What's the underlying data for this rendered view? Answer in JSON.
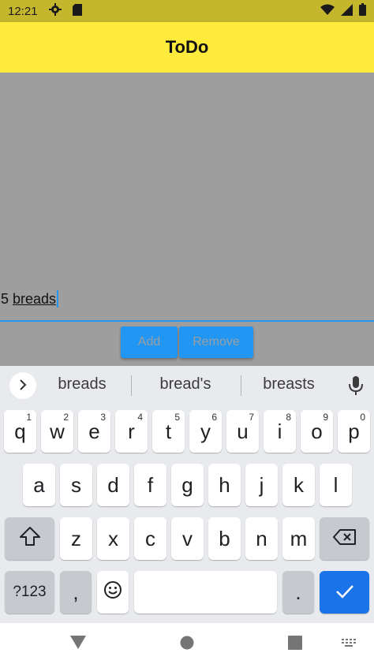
{
  "status_bar": {
    "time": "12:21",
    "icons": [
      "gear-icon",
      "sd-card-icon",
      "wifi-icon",
      "signal-icon",
      "battery-icon"
    ]
  },
  "app_bar": {
    "title": "ToDo",
    "color": "#ffeb3b"
  },
  "input": {
    "prefix": "5 ",
    "word": "breads"
  },
  "buttons": {
    "add": "Add",
    "remove": "Remove",
    "color": "#2196f3"
  },
  "keyboard": {
    "suggestions": [
      "breads",
      "bread's",
      "breasts"
    ],
    "row1": [
      {
        "k": "q",
        "h": "1"
      },
      {
        "k": "w",
        "h": "2"
      },
      {
        "k": "e",
        "h": "3"
      },
      {
        "k": "r",
        "h": "4"
      },
      {
        "k": "t",
        "h": "5"
      },
      {
        "k": "y",
        "h": "6"
      },
      {
        "k": "u",
        "h": "7"
      },
      {
        "k": "i",
        "h": "8"
      },
      {
        "k": "o",
        "h": "9"
      },
      {
        "k": "p",
        "h": "0"
      }
    ],
    "row2": [
      "a",
      "s",
      "d",
      "f",
      "g",
      "h",
      "j",
      "k",
      "l"
    ],
    "row3": [
      "z",
      "x",
      "c",
      "v",
      "b",
      "n",
      "m"
    ],
    "symbols_label": "?123",
    "comma_label": ",",
    "period_label": "."
  },
  "nav_bar": {
    "icons": [
      "back-triangle-icon",
      "home-circle-icon",
      "recents-square-icon",
      "keyboard-switch-icon"
    ]
  }
}
